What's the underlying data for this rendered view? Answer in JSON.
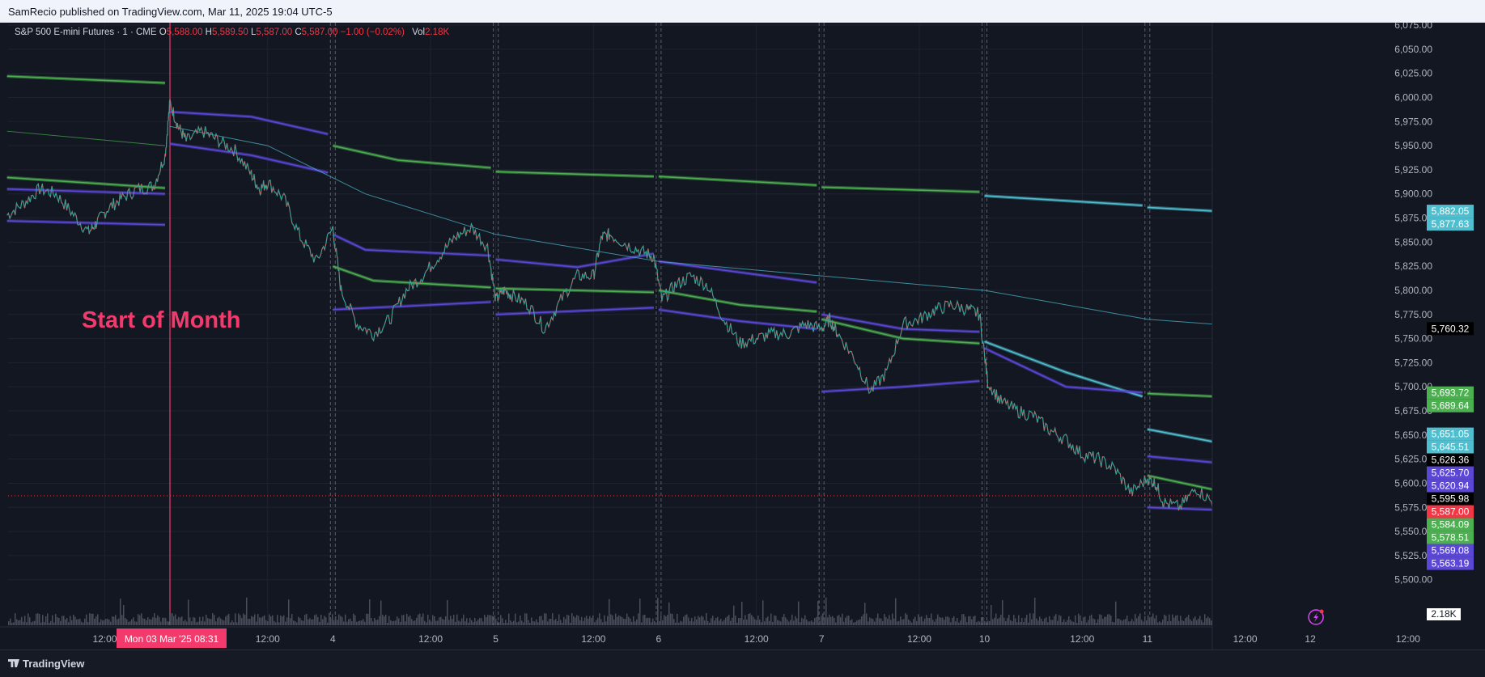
{
  "header": {
    "publish_text": "SamRecio published on TradingView.com, Mar 11, 2025 19:04 UTC-5"
  },
  "legend": {
    "symbol": "S&P 500 E-mini Futures · 1 · CME",
    "open_label": "O",
    "open": "5,588.00",
    "high_label": "H",
    "high": "5,589.50",
    "low_label": "L",
    "low": "5,587.00",
    "close_label": "C",
    "close": "5,587.00",
    "change": "−1.00 (−0.02%)",
    "vol_label": "Vol",
    "vol": "2.18K"
  },
  "annotation": {
    "text": "Start of Month",
    "color": "#f23a6c"
  },
  "footer": {
    "brand": "TradingView"
  },
  "colors": {
    "green": "#4caf50",
    "purple": "#5b47d6",
    "cyan": "#4fbfd0",
    "red": "#f23645",
    "bg": "#131722"
  },
  "chart_data": {
    "type": "line",
    "title": "S&P 500 E-mini Futures · 1 · CME",
    "ylim": [
      5480,
      6080
    ],
    "y_ticks": [
      "6,075.00",
      "6,050.00",
      "6,025.00",
      "6,000.00",
      "5,975.00",
      "5,950.00",
      "5,925.00",
      "5,900.00",
      "5,875.00",
      "5,850.00",
      "5,825.00",
      "5,800.00",
      "5,775.00",
      "5,750.00",
      "5,725.00",
      "5,700.00",
      "5,675.00",
      "5,650.00",
      "5,625.00",
      "5,600.00",
      "5,575.00",
      "5,550.00",
      "5,525.00",
      "5,500.00"
    ],
    "y_tick_values": [
      6075,
      6050,
      6025,
      6000,
      5975,
      5950,
      5925,
      5900,
      5875,
      5850,
      5825,
      5800,
      5775,
      5750,
      5725,
      5700,
      5675,
      5650,
      5625,
      5600,
      5575,
      5550,
      5525,
      5500
    ],
    "x_ticks": [
      "12:00",
      "Mon 03 Mar '25   08:31",
      "12:00",
      "4",
      "12:00",
      "5",
      "12:00",
      "6",
      "12:00",
      "7",
      "12:00",
      "10",
      "12:00",
      "11",
      "12:00",
      "12",
      "12:00"
    ],
    "x_tick_index": [
      0.6,
      1.0,
      1.6,
      2.0,
      2.6,
      3.0,
      3.6,
      4.0,
      4.6,
      5.0,
      5.6,
      6.0,
      6.6,
      7.0,
      7.6,
      8.0,
      8.6
    ],
    "session_index": [
      1.0,
      2.0,
      3.0,
      4.0,
      5.0,
      6.0,
      7.0,
      8.0
    ],
    "price_path": {
      "x": [
        0,
        0.1,
        0.2,
        0.3,
        0.4,
        0.5,
        0.55,
        0.62,
        0.7,
        0.8,
        0.9,
        0.97,
        1.0,
        1.05,
        1.1,
        1.2,
        1.3,
        1.4,
        1.5,
        1.55,
        1.6,
        1.7,
        1.8,
        1.9,
        2.0,
        2.05,
        2.15,
        2.25,
        2.35,
        2.45,
        2.55,
        2.65,
        2.75,
        2.85,
        2.95,
        3.0,
        3.05,
        3.1,
        3.2,
        3.3,
        3.4,
        3.5,
        3.6,
        3.65,
        3.7,
        3.8,
        3.9,
        3.97,
        4.02,
        4.1,
        4.2,
        4.3,
        4.4,
        4.5,
        4.6,
        4.7,
        4.8,
        4.9,
        5.0,
        5.05,
        5.1,
        5.2,
        5.3,
        5.4,
        5.5,
        5.6,
        5.7,
        5.8,
        5.9,
        5.97,
        6.02,
        6.1,
        6.2,
        6.3,
        6.4,
        6.5,
        6.6,
        6.7,
        6.8,
        6.9,
        7.0,
        7.05,
        7.1,
        7.2,
        7.3,
        7.4,
        7.5,
        7.6,
        7.7,
        7.8,
        7.85,
        7.9,
        7.98
      ],
      "y": [
        5878,
        5890,
        5905,
        5900,
        5880,
        5860,
        5870,
        5885,
        5895,
        5905,
        5908,
        5940,
        5995,
        5970,
        5955,
        5965,
        5955,
        5945,
        5920,
        5905,
        5912,
        5895,
        5855,
        5830,
        5865,
        5800,
        5765,
        5755,
        5770,
        5800,
        5815,
        5835,
        5855,
        5865,
        5845,
        5790,
        5800,
        5795,
        5785,
        5760,
        5790,
        5815,
        5815,
        5855,
        5858,
        5848,
        5840,
        5835,
        5790,
        5805,
        5815,
        5805,
        5770,
        5745,
        5750,
        5755,
        5755,
        5765,
        5760,
        5770,
        5755,
        5730,
        5695,
        5715,
        5765,
        5770,
        5780,
        5785,
        5780,
        5775,
        5705,
        5685,
        5675,
        5670,
        5655,
        5645,
        5630,
        5625,
        5615,
        5590,
        5605,
        5600,
        5580,
        5575,
        5595,
        5580,
        5560,
        5555,
        5575,
        5610,
        5600,
        5590,
        5585
      ]
    },
    "series": [
      {
        "name": "",
        "color": "#4caf50",
        "points": [
          [
            0,
            6022
          ],
          [
            0.97,
            6015
          ]
        ]
      },
      {
        "name": "",
        "color": "#4caf50",
        "points": [
          [
            0,
            5917
          ],
          [
            0.97,
            5906
          ]
        ]
      },
      {
        "name": "",
        "color": "#5b47d6",
        "points": [
          [
            0,
            5905
          ],
          [
            0.97,
            5900
          ]
        ]
      },
      {
        "name": "",
        "color": "#5b47d6",
        "points": [
          [
            0,
            5872
          ],
          [
            0.97,
            5868
          ]
        ]
      },
      {
        "name": "",
        "color": "#5b47d6",
        "points": [
          [
            1.0,
            5985
          ],
          [
            1.5,
            5980
          ],
          [
            1.97,
            5962
          ]
        ]
      },
      {
        "name": "",
        "color": "#5b47d6",
        "points": [
          [
            1.0,
            5952
          ],
          [
            1.5,
            5940
          ],
          [
            1.97,
            5922
          ]
        ]
      },
      {
        "name": "",
        "color": "#4caf50",
        "points": [
          [
            2.0,
            5950
          ],
          [
            2.4,
            5935
          ],
          [
            2.97,
            5927
          ]
        ]
      },
      {
        "name": "",
        "color": "#4caf50",
        "points": [
          [
            3.0,
            5923
          ],
          [
            3.97,
            5918
          ]
        ]
      },
      {
        "name": "",
        "color": "#4caf50",
        "points": [
          [
            4.0,
            5918
          ],
          [
            4.97,
            5909
          ]
        ]
      },
      {
        "name": "",
        "color": "#4caf50",
        "points": [
          [
            5.0,
            5907
          ],
          [
            5.97,
            5902
          ]
        ]
      },
      {
        "name": "",
        "color": "#4fbfd0",
        "points": [
          [
            6.0,
            5898
          ],
          [
            6.97,
            5888
          ]
        ]
      },
      {
        "name": "",
        "color": "#4fbfd0",
        "points": [
          [
            7.0,
            5886
          ],
          [
            7.97,
            5877
          ]
        ]
      },
      {
        "name": "",
        "color": "#5b47d6",
        "points": [
          [
            2.0,
            5858
          ],
          [
            2.2,
            5842
          ],
          [
            2.97,
            5836
          ]
        ]
      },
      {
        "name": "",
        "color": "#4caf50",
        "points": [
          [
            2.0,
            5825
          ],
          [
            2.25,
            5810
          ],
          [
            2.97,
            5803
          ]
        ]
      },
      {
        "name": "",
        "color": "#5b47d6",
        "points": [
          [
            2.0,
            5780
          ],
          [
            2.5,
            5784
          ],
          [
            2.97,
            5788
          ]
        ]
      },
      {
        "name": "",
        "color": "#5b47d6",
        "points": [
          [
            3.0,
            5832
          ],
          [
            3.5,
            5824
          ],
          [
            3.97,
            5838
          ]
        ]
      },
      {
        "name": "",
        "color": "#4caf50",
        "points": [
          [
            3.0,
            5802
          ],
          [
            3.97,
            5798
          ]
        ]
      },
      {
        "name": "",
        "color": "#5b47d6",
        "points": [
          [
            3.0,
            5775
          ],
          [
            3.97,
            5782
          ]
        ]
      },
      {
        "name": "",
        "color": "#5b47d6",
        "points": [
          [
            4.0,
            5830
          ],
          [
            4.97,
            5808
          ]
        ]
      },
      {
        "name": "",
        "color": "#4caf50",
        "points": [
          [
            4.0,
            5800
          ],
          [
            4.5,
            5785
          ],
          [
            4.97,
            5778
          ]
        ]
      },
      {
        "name": "",
        "color": "#5b47d6",
        "points": [
          [
            4.0,
            5780
          ],
          [
            4.5,
            5768
          ],
          [
            4.97,
            5760
          ]
        ]
      },
      {
        "name": "",
        "color": "#5b47d6",
        "points": [
          [
            5.0,
            5775
          ],
          [
            5.5,
            5760
          ],
          [
            5.97,
            5757
          ]
        ]
      },
      {
        "name": "",
        "color": "#4caf50",
        "points": [
          [
            5.0,
            5770
          ],
          [
            5.5,
            5750
          ],
          [
            5.97,
            5745
          ]
        ]
      },
      {
        "name": "",
        "color": "#5b47d6",
        "points": [
          [
            5.0,
            5695
          ],
          [
            5.5,
            5700
          ],
          [
            5.97,
            5706
          ]
        ]
      },
      {
        "name": "",
        "color": "#4fbfd0",
        "points": [
          [
            6.0,
            5747
          ],
          [
            6.5,
            5715
          ],
          [
            6.97,
            5690
          ]
        ]
      },
      {
        "name": "",
        "color": "#5b47d6",
        "points": [
          [
            6.0,
            5740
          ],
          [
            6.5,
            5700
          ],
          [
            6.97,
            5694
          ]
        ]
      },
      {
        "name": "",
        "color": "#4caf50",
        "points": [
          [
            7.0,
            5693
          ],
          [
            7.97,
            5686
          ]
        ]
      },
      {
        "name": "",
        "color": "#4fbfd0",
        "points": [
          [
            7.0,
            5656
          ],
          [
            7.5,
            5640
          ],
          [
            7.97,
            5641
          ]
        ]
      },
      {
        "name": "",
        "color": "#5b47d6",
        "points": [
          [
            7.0,
            5628
          ],
          [
            7.5,
            5620
          ],
          [
            7.97,
            5620
          ]
        ]
      },
      {
        "name": "",
        "color": "#4caf50",
        "points": [
          [
            7.0,
            5608
          ],
          [
            7.5,
            5590
          ],
          [
            7.97,
            5585
          ]
        ]
      },
      {
        "name": "",
        "color": "#5b47d6",
        "points": [
          [
            7.0,
            5575
          ],
          [
            7.5,
            5572
          ],
          [
            7.97,
            5571
          ]
        ]
      }
    ],
    "last_price": 5587.0,
    "price_tags": [
      {
        "text": "5,882.05",
        "color": "#4fbfd0",
        "value": 5882.05
      },
      {
        "text": "5,877.63",
        "color": "#4fbfd0",
        "value": 5877.63
      },
      {
        "text": "5,760.32",
        "color": "#000000",
        "value": 5760.32
      },
      {
        "text": "5,693.72",
        "color": "#4caf50",
        "value": 5693.72
      },
      {
        "text": "5,689.64",
        "color": "#4caf50",
        "value": 5689.64
      },
      {
        "text": "5,651.05",
        "color": "#4fbfd0",
        "value": 5651.05
      },
      {
        "text": "5,645.51",
        "color": "#4fbfd0",
        "value": 5645.51
      },
      {
        "text": "5,626.36",
        "color": "#000000",
        "value": 5626.36
      },
      {
        "text": "5,625.70",
        "color": "#5b47d6",
        "value": 5625.7
      },
      {
        "text": "5,620.94",
        "color": "#5b47d6",
        "value": 5620.94
      },
      {
        "text": "5,595.98",
        "color": "#000000",
        "value": 5595.98
      },
      {
        "text": "5,587.00",
        "color": "#f23645",
        "value": 5587.0
      },
      {
        "text": "5,584.09",
        "color": "#4caf50",
        "value": 5584.09
      },
      {
        "text": "5,578.51",
        "color": "#4caf50",
        "value": 5578.51
      },
      {
        "text": "5,569.08",
        "color": "#5b47d6",
        "value": 5569.08
      },
      {
        "text": "5,563.19",
        "color": "#5b47d6",
        "value": 5563.19
      }
    ],
    "volume_tag": "2.18K"
  }
}
